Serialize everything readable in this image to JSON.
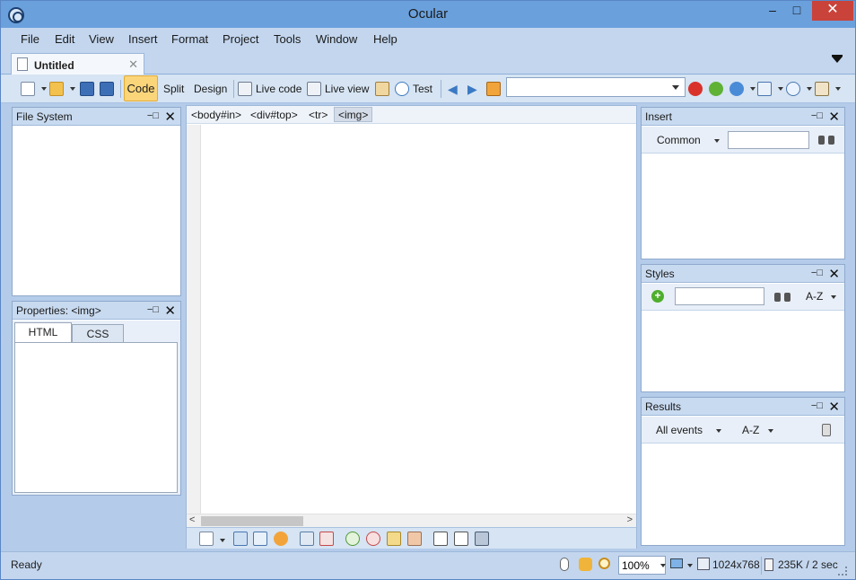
{
  "window": {
    "title": "Ocular"
  },
  "menu": [
    "File",
    "Edit",
    "View",
    "Insert",
    "Format",
    "Project",
    "Tools",
    "Window",
    "Help"
  ],
  "document_tab": {
    "label": "Untitled"
  },
  "toolbar": {
    "code_label": "Code",
    "split_label": "Split",
    "design_label": "Design",
    "live_code_label": "Live code",
    "live_view_label": "Live view",
    "test_label": "Test",
    "url_value": ""
  },
  "file_system_panel": {
    "title": "File System"
  },
  "properties_panel": {
    "title": "Properties: <img>",
    "tabs": [
      "HTML",
      "CSS"
    ]
  },
  "breadcrumb": [
    "<body#in>",
    "<div#top>",
    "<tr>",
    "<img>"
  ],
  "insert_panel": {
    "title": "Insert",
    "category": "Common",
    "search_value": ""
  },
  "styles_panel": {
    "title": "Styles",
    "sort": "A-Z",
    "search_value": ""
  },
  "results_panel": {
    "title": "Results",
    "filter": "All events",
    "sort": "A-Z"
  },
  "status": {
    "ready": "Ready",
    "zoom": "100%",
    "resolution": "1024x768",
    "size_time": "235K / 2 sec"
  },
  "colors": {
    "accent": "#fbd57a",
    "titlebar": "#6aa0dc",
    "close": "#c9433a"
  }
}
